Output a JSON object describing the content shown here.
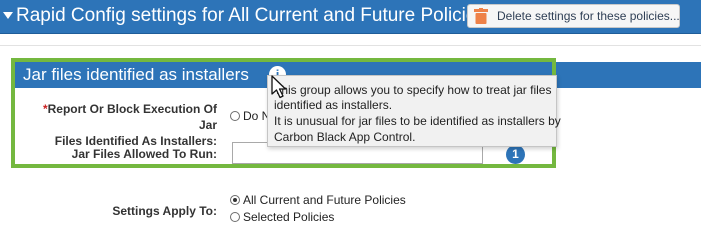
{
  "header": {
    "title": "Rapid Config settings for All Current and Future Policies",
    "delete_button_label": "Delete settings for these policies..."
  },
  "section": {
    "title": "Jar files identified as installers",
    "info_icon_glyph": "i",
    "report_block": {
      "label_required_mark": "*",
      "label_line1": "Report Or Block Execution Of Jar",
      "label_line2": "Files Identified As Installers:",
      "option_visible_text": "Do N"
    },
    "jar_allowed": {
      "label": "Jar Files Allowed To Run:",
      "value": "",
      "badge_count": "1"
    }
  },
  "tooltip": {
    "lines": [
      "This group allows you to specify how to treat jar files",
      "identified as installers.",
      "It is unusual for jar files to be identified as installers by",
      "Carbon Black App Control."
    ]
  },
  "settings_apply": {
    "label": "Settings Apply To:",
    "options": [
      {
        "label": "All Current and Future Policies",
        "selected": true
      },
      {
        "label": "Selected Policies",
        "selected": false
      }
    ]
  },
  "colors": {
    "header_blue": "#2d74b8",
    "highlight_green": "#74b83f",
    "required_red": "#c91f1f",
    "trash_orange": "#ee8148"
  },
  "icons": {
    "collapse": "caret-down-icon",
    "delete": "trash-icon",
    "info": "info-icon",
    "pointer": "mouse-cursor-icon"
  }
}
